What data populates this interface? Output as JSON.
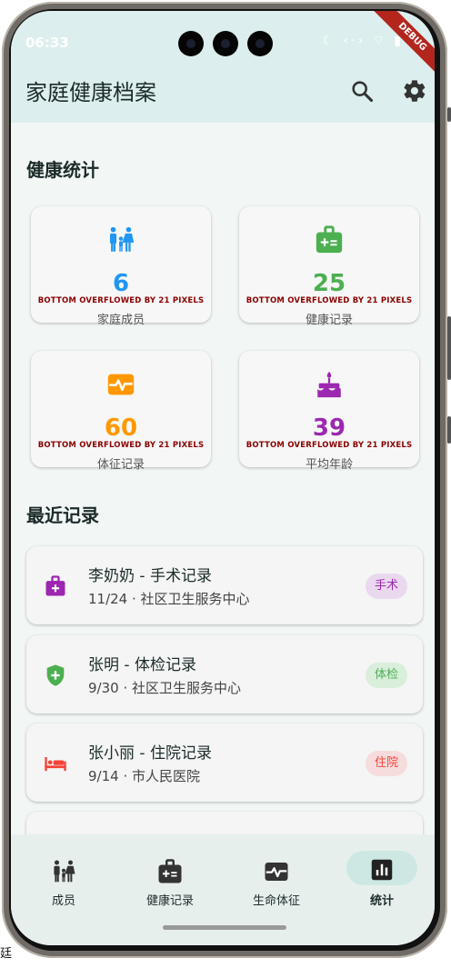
{
  "status_bar": {
    "time": "06:33",
    "icons": "☾ ‹·› ⌔ ▮"
  },
  "debug_banner": "DEBUG",
  "app_bar": {
    "title": "家庭健康档案",
    "search_icon": "search-icon",
    "settings_icon": "gear-icon"
  },
  "stats_section": {
    "title": "健康统计",
    "cards": [
      {
        "value": "6",
        "label": "家庭成员",
        "icon": "family-icon",
        "color": "#2196f3",
        "overflow": "BOTTOM OVERFLOWED BY 21 PIXELS"
      },
      {
        "value": "25",
        "label": "健康记录",
        "icon": "medical-bag-icon",
        "color": "#4caf50",
        "overflow": "BOTTOM OVERFLOWED BY 21 PIXELS"
      },
      {
        "value": "60",
        "label": "体征记录",
        "icon": "heartbeat-icon",
        "color": "#ff9800",
        "overflow": "BOTTOM OVERFLOWED BY 21 PIXELS"
      },
      {
        "value": "39",
        "label": "平均年龄",
        "icon": "cake-icon",
        "color": "#9c27b0",
        "overflow": "BOTTOM OVERFLOWED BY 21 PIXELS"
      }
    ]
  },
  "recent_section": {
    "title": "最近记录",
    "records": [
      {
        "title": "李奶奶 - 手术记录",
        "subtitle": "11/24 · 社区卫生服务中心",
        "tag": "手术",
        "icon": "medical-bag-icon",
        "color": "#9c27b0",
        "tag_bg": "#ead8ef"
      },
      {
        "title": "张明 - 体检记录",
        "subtitle": "9/30 · 社区卫生服务中心",
        "tag": "体检",
        "icon": "shield-plus-icon",
        "color": "#4caf50",
        "tag_bg": "#d9eedb"
      },
      {
        "title": "张小丽 - 住院记录",
        "subtitle": "9/14 · 市人民医院",
        "tag": "住院",
        "icon": "hospital-bed-icon",
        "color": "#f44336",
        "tag_bg": "#f6dcdc"
      }
    ]
  },
  "bottom_nav": {
    "items": [
      {
        "label": "成员",
        "icon": "family-icon",
        "selected": false
      },
      {
        "label": "健康记录",
        "icon": "medical-bag-icon",
        "selected": false
      },
      {
        "label": "生命体征",
        "icon": "monitor-heart-icon",
        "selected": false
      },
      {
        "label": "统计",
        "icon": "bar-chart-icon",
        "selected": true
      }
    ]
  },
  "background_fragment": "廷"
}
